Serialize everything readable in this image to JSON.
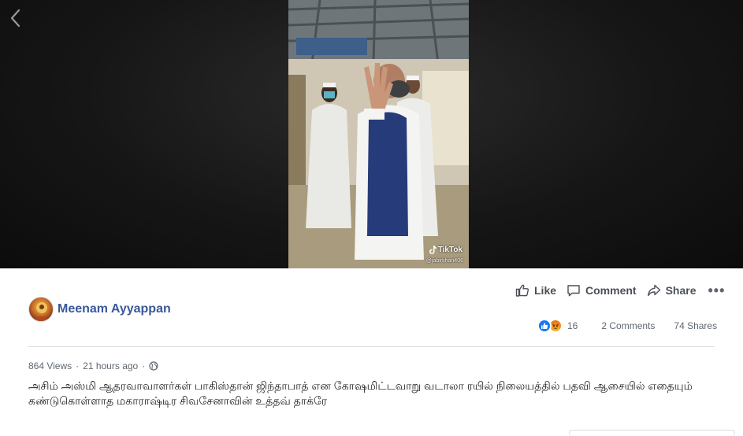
{
  "video": {
    "watermark": "TikTok",
    "watermark_handle": "@jabirkhan406",
    "back_icon": "chevron-left-icon"
  },
  "actions": {
    "like_label": "Like",
    "comment_label": "Comment",
    "share_label": "Share",
    "more_label": "•••"
  },
  "poster": {
    "name": "Meenam Ayyappan"
  },
  "stats": {
    "reactions_count": "16",
    "comments": "2 Comments",
    "shares": "74 Shares",
    "reaction_icons": [
      "like-icon",
      "angry-icon"
    ]
  },
  "meta": {
    "views": "864 Views",
    "separator": "·",
    "time": "21 hours ago",
    "separator2": "·",
    "privacy_icon": "globe-icon"
  },
  "caption": "அசிம் அஸ்மி ஆதரவாவாளர்கள் பாகிஸ்தான் ஜிந்தாபாத் என கோஷமிட்டவாறு வடாலா ரயில் நிலையத்தில் பதவி ஆசையில் எதையும் கண்டுகொள்ளாத மகாராஷ்டிர சிவசேனாவின் உத்தவ் தாக்ரே",
  "colors": {
    "link": "#385898",
    "like_blue": "#1877f2",
    "text_secondary": "#606770"
  }
}
